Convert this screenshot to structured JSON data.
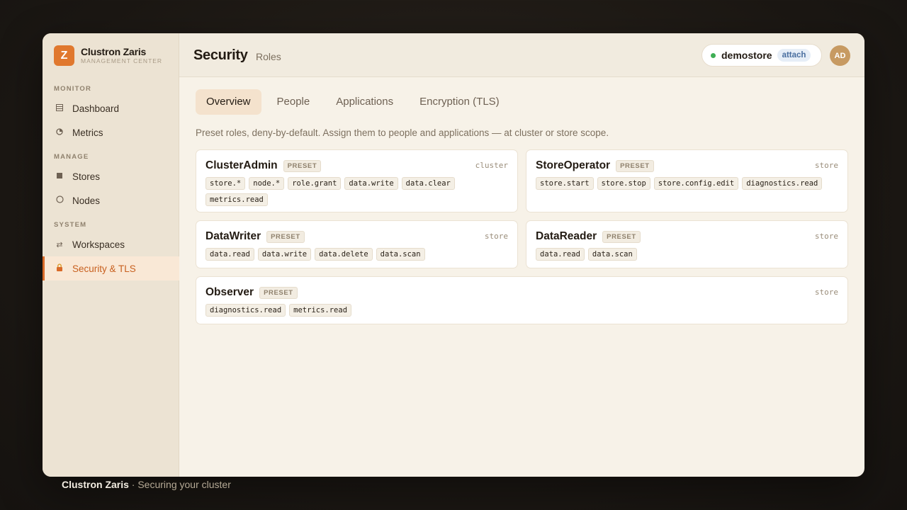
{
  "app": {
    "name": "Clustron Zaris",
    "subtitle": "MANAGEMENT CENTER",
    "logo_letter": "Z"
  },
  "sidebar": {
    "sections": [
      {
        "label": "MONITOR",
        "items": [
          {
            "label": "Dashboard",
            "icon": "dashboard-icon"
          },
          {
            "label": "Metrics",
            "icon": "chart-pie-icon"
          }
        ]
      },
      {
        "label": "MANAGE",
        "items": [
          {
            "label": "Stores",
            "icon": "stores-icon"
          },
          {
            "label": "Nodes",
            "icon": "node-circle-icon"
          }
        ]
      },
      {
        "label": "SYSTEM",
        "items": [
          {
            "label": "Workspaces",
            "icon": "swap-arrows-icon"
          },
          {
            "label": "Security & TLS",
            "icon": "lock-icon",
            "active": true
          }
        ]
      }
    ]
  },
  "header": {
    "title": "Security",
    "subtitle": "Roles",
    "store": {
      "name": "demostore",
      "status_color": "#3fae55",
      "action": "attach"
    },
    "avatar_initials": "AD"
  },
  "tabs": [
    {
      "label": "Overview",
      "active": true
    },
    {
      "label": "People"
    },
    {
      "label": "Applications"
    },
    {
      "label": "Encryption (TLS)"
    }
  ],
  "description": "Preset roles, deny-by-default. Assign them to people and applications — at cluster or store scope.",
  "roles": [
    {
      "name": "ClusterAdmin",
      "badge": "PRESET",
      "scope": "cluster",
      "permissions": [
        "store.*",
        "node.*",
        "role.grant",
        "data.write",
        "data.clear",
        "metrics.read"
      ]
    },
    {
      "name": "StoreOperator",
      "badge": "PRESET",
      "scope": "store",
      "permissions": [
        "store.start",
        "store.stop",
        "store.config.edit",
        "diagnostics.read"
      ]
    },
    {
      "name": "DataWriter",
      "badge": "PRESET",
      "scope": "store",
      "permissions": [
        "data.read",
        "data.write",
        "data.delete",
        "data.scan"
      ]
    },
    {
      "name": "DataReader",
      "badge": "PRESET",
      "scope": "store",
      "permissions": [
        "data.read",
        "data.scan"
      ]
    },
    {
      "name": "Observer",
      "badge": "PRESET",
      "scope": "store",
      "permissions": [
        "diagnostics.read",
        "metrics.read"
      ]
    }
  ],
  "caption": {
    "title": "Clustron Zaris",
    "text": " · Securing your cluster"
  },
  "colors": {
    "accent": "#d96a28",
    "sidebar_bg": "#ece3d3",
    "page_bg": "#f7f2e8"
  }
}
